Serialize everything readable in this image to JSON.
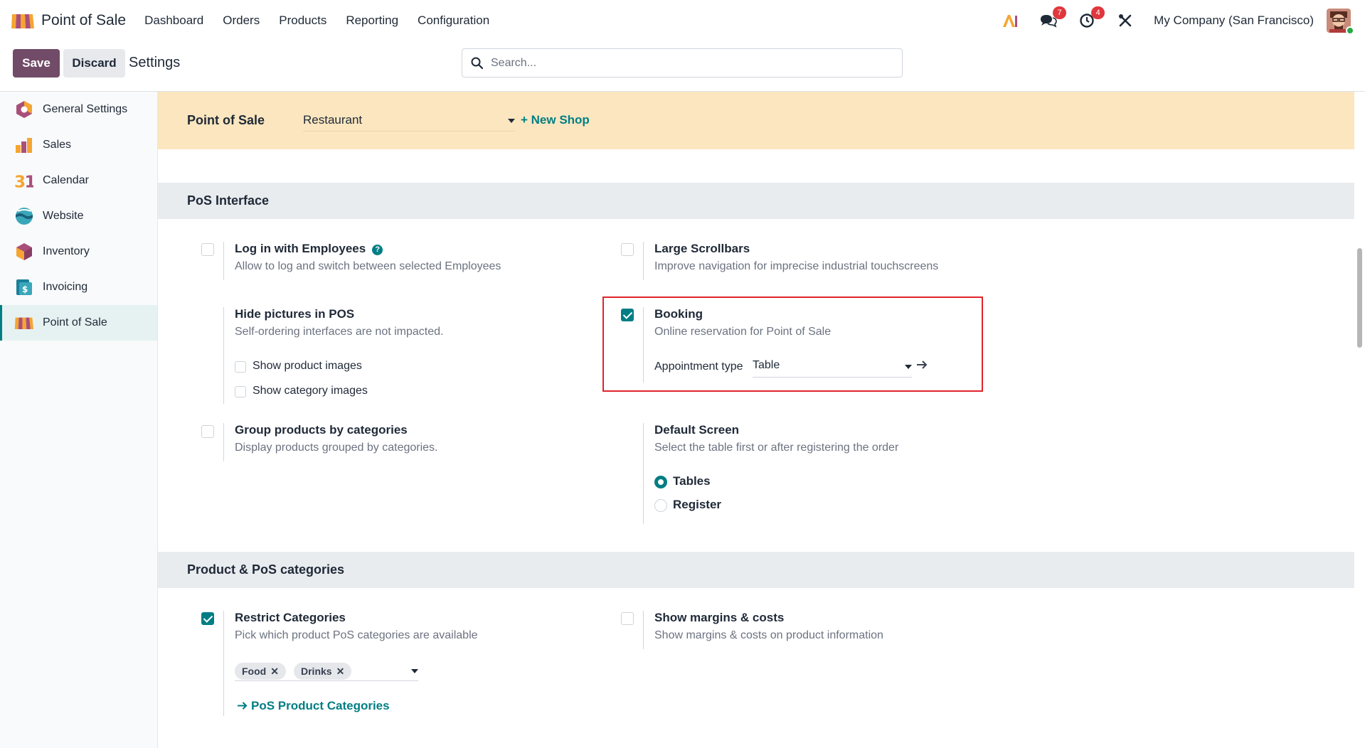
{
  "app": {
    "name": "Point of Sale"
  },
  "menu": [
    {
      "label": "Dashboard"
    },
    {
      "label": "Orders"
    },
    {
      "label": "Products"
    },
    {
      "label": "Reporting"
    },
    {
      "label": "Configuration"
    }
  ],
  "systray": {
    "ai_icon": "ai-icon",
    "messages_badge": "7",
    "activities_badge": "4",
    "company": "My Company (San Francisco)"
  },
  "control": {
    "save_label": "Save",
    "discard_label": "Discard",
    "title": "Settings",
    "search_placeholder": "Search..."
  },
  "sidebar": {
    "items": [
      {
        "label": "General Settings",
        "icon": "general-settings-icon"
      },
      {
        "label": "Sales",
        "icon": "sales-icon"
      },
      {
        "label": "Calendar",
        "icon": "calendar-icon"
      },
      {
        "label": "Website",
        "icon": "website-icon"
      },
      {
        "label": "Inventory",
        "icon": "inventory-icon"
      },
      {
        "label": "Invoicing",
        "icon": "invoicing-icon"
      },
      {
        "label": "Point of Sale",
        "icon": "point-of-sale-icon",
        "active": true
      }
    ]
  },
  "pos_banner": {
    "label": "Point of Sale",
    "selected_shop": "Restaurant",
    "new_shop": "+ New Shop"
  },
  "pos_interface": {
    "heading": "PoS Interface",
    "log_in_employees": {
      "title": "Log in with Employees",
      "desc": "Allow to log and switch between selected Employees",
      "checked": false,
      "help": "?"
    },
    "large_scrollbars": {
      "title": "Large Scrollbars",
      "desc": "Improve navigation for imprecise industrial touchscreens",
      "checked": false
    },
    "hide_pictures": {
      "title": "Hide pictures in POS",
      "desc": "Self-ordering interfaces are not impacted.",
      "show_product_images": "Show product images",
      "show_category_images": "Show category images"
    },
    "booking": {
      "title": "Booking",
      "desc": "Online reservation for Point of Sale",
      "checked": true,
      "appointment_label": "Appointment type",
      "appointment_value": "Table"
    },
    "group_products": {
      "title": "Group products by categories",
      "desc": "Display products grouped by categories.",
      "checked": false
    },
    "default_screen": {
      "title": "Default Screen",
      "desc": "Select the table first or after registering the order",
      "options": [
        "Tables",
        "Register"
      ],
      "selected": "Tables"
    }
  },
  "product_categories": {
    "heading": "Product & PoS categories",
    "restrict_categories": {
      "title": "Restrict Categories",
      "desc": "Pick which product PoS categories are available",
      "checked": true,
      "tags": [
        "Food",
        "Drinks"
      ],
      "remove_glyph": "✕",
      "link": "PoS Product Categories"
    },
    "show_margins": {
      "title": "Show margins & costs",
      "desc": "Show margins & costs on product information",
      "checked": false
    }
  },
  "colors": {
    "brand": "#714b67",
    "accent": "#017e84",
    "banner": "#fbe6bf",
    "highlight": "#e0242b"
  }
}
